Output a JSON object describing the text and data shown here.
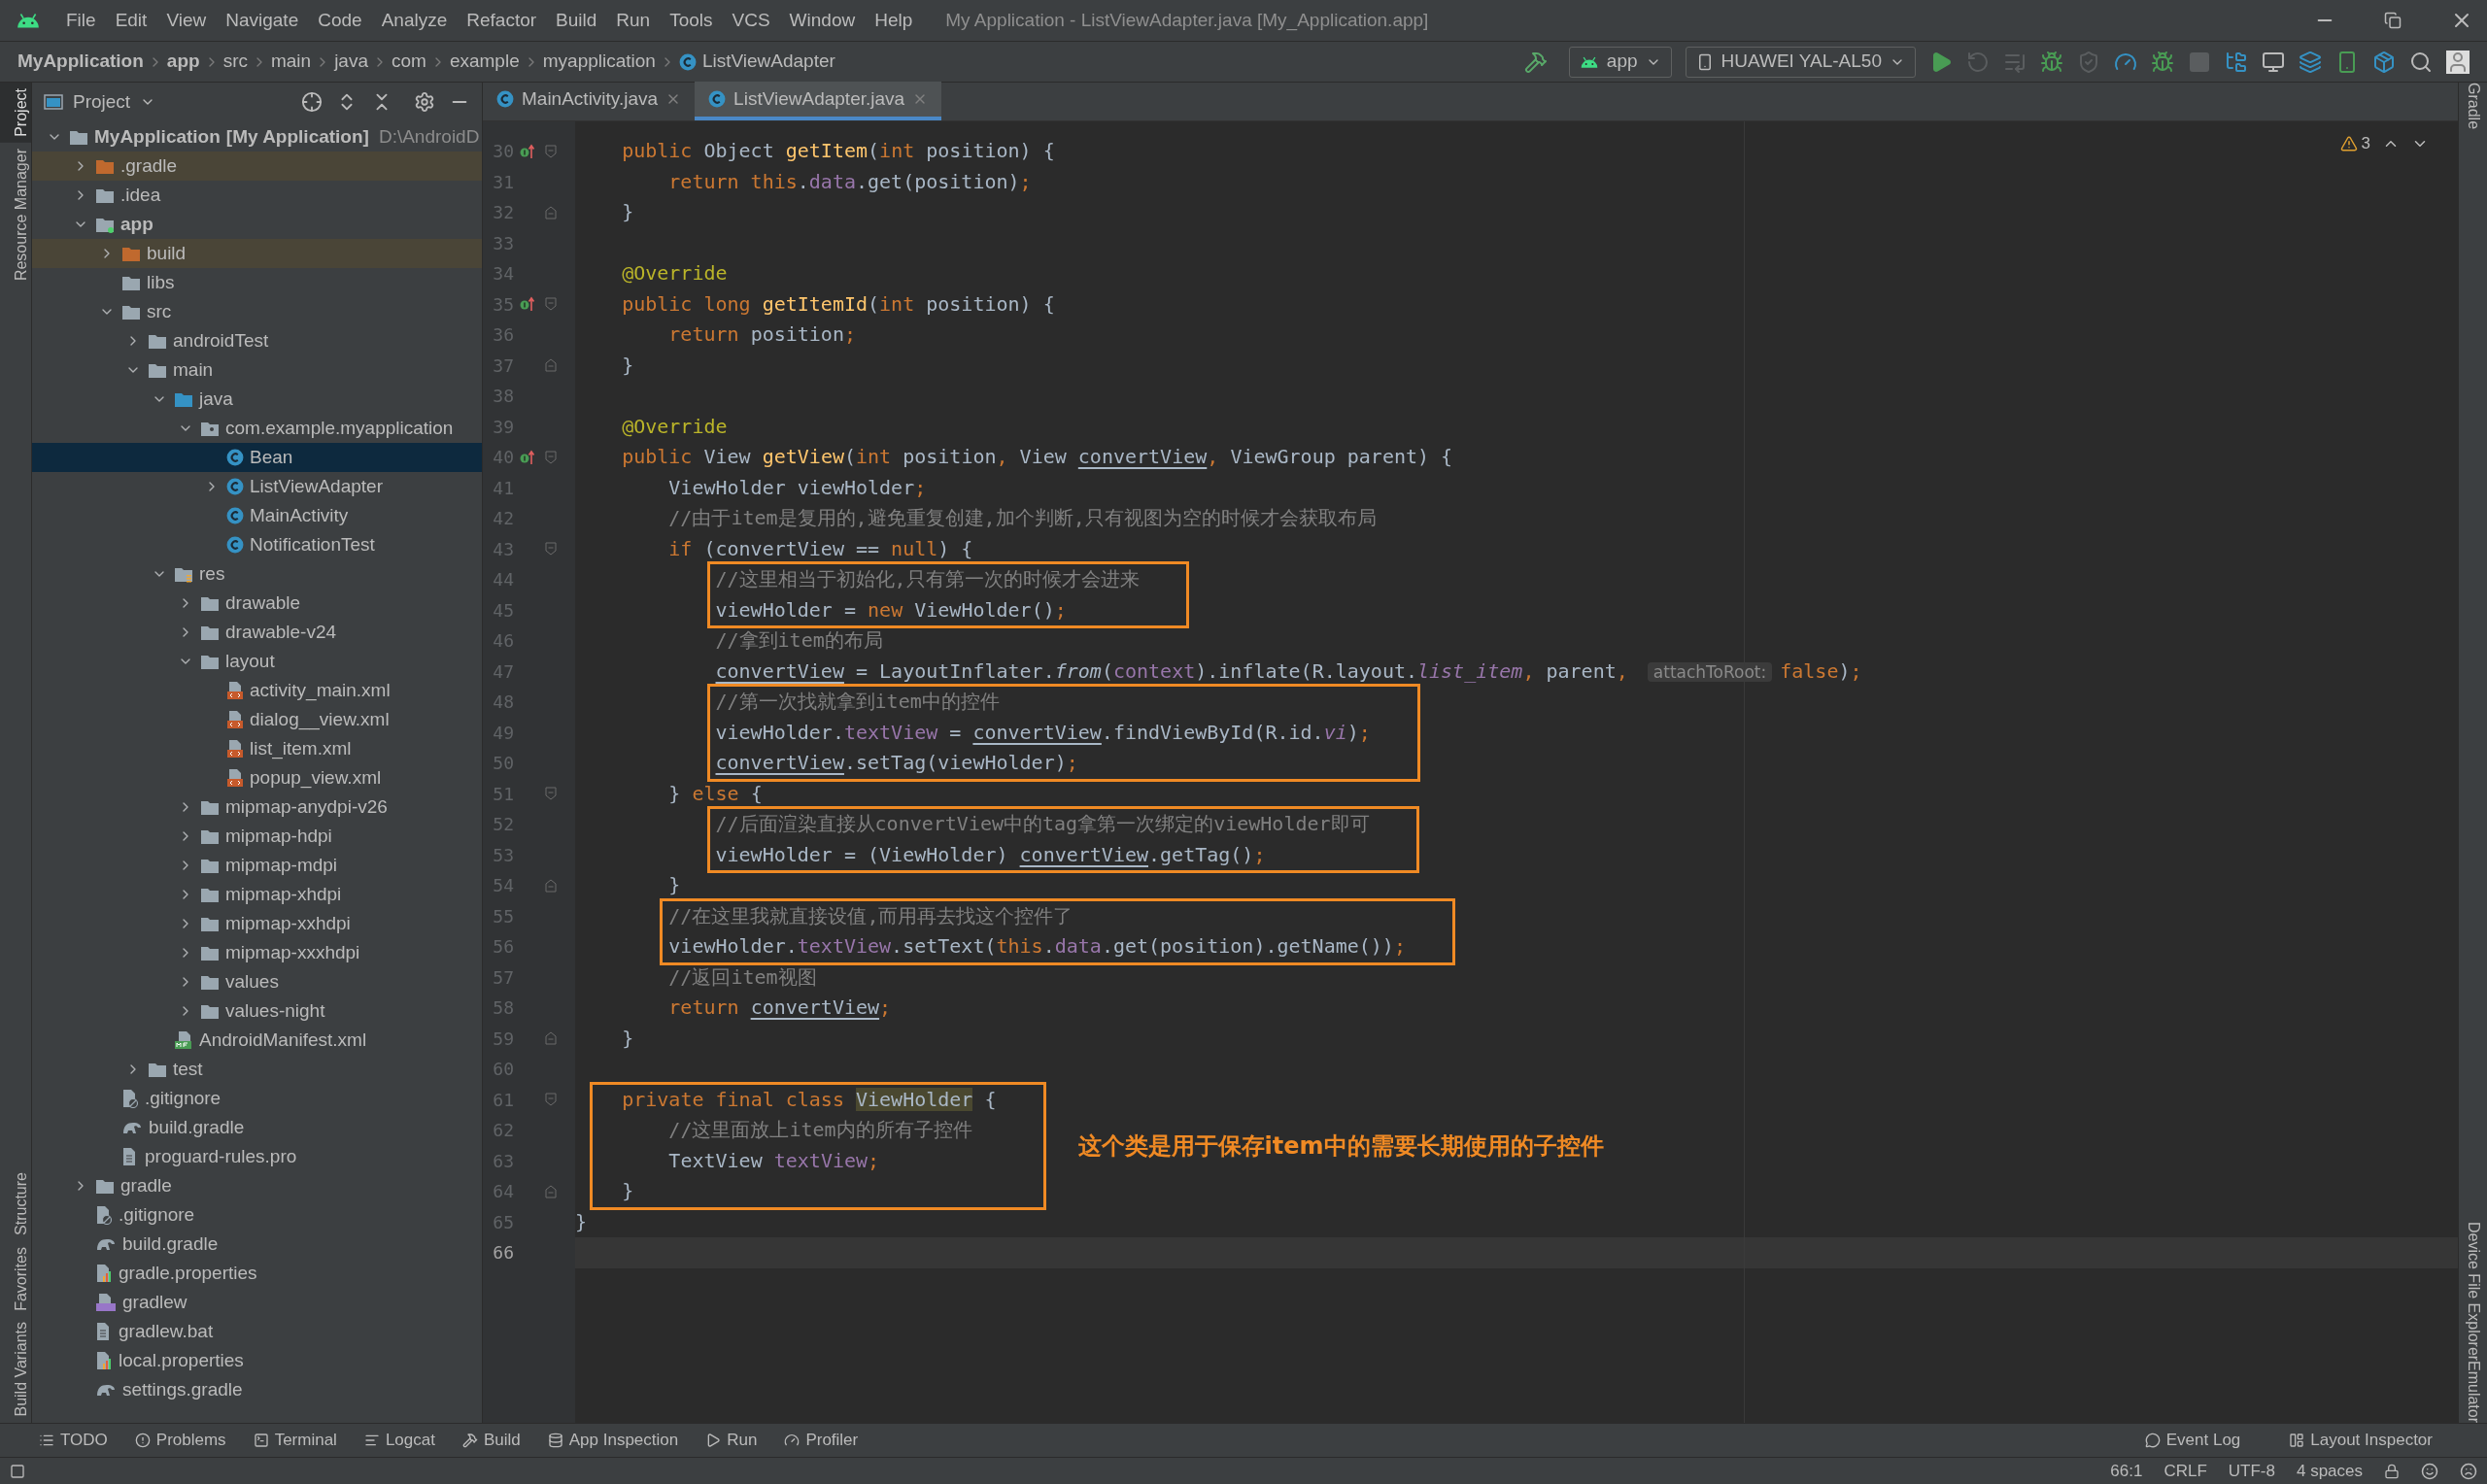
{
  "window": {
    "title": "My Application - ListViewAdapter.java [My_Application.app]"
  },
  "menu": [
    "File",
    "Edit",
    "View",
    "Navigate",
    "Code",
    "Analyze",
    "Refactor",
    "Build",
    "Run",
    "Tools",
    "VCS",
    "Window",
    "Help"
  ],
  "breadcrumb": [
    {
      "label": "MyApplication",
      "kind": "module"
    },
    {
      "label": "app",
      "kind": "module"
    },
    {
      "label": "src",
      "kind": "folder"
    },
    {
      "label": "main",
      "kind": "folder"
    },
    {
      "label": "java",
      "kind": "folder"
    },
    {
      "label": "com",
      "kind": "folder"
    },
    {
      "label": "example",
      "kind": "folder"
    },
    {
      "label": "myapplication",
      "kind": "folder"
    },
    {
      "label": "ListViewAdapter",
      "kind": "class"
    }
  ],
  "toolbar": {
    "run_config": "app",
    "device": "HUAWEI YAL-AL50"
  },
  "left_tool_tabs": {
    "top": [
      {
        "label": "Project",
        "selected": true
      },
      {
        "label": "Resource Manager",
        "selected": false
      }
    ],
    "bottom": [
      {
        "label": "Structure",
        "selected": false
      },
      {
        "label": "Favorites",
        "selected": false
      },
      {
        "label": "Build Variants",
        "selected": false
      }
    ]
  },
  "right_tool_tabs": {
    "top": [
      {
        "label": "Gradle"
      }
    ],
    "bottom": [
      {
        "label": "Device File Explorer"
      },
      {
        "label": "Emulator"
      }
    ]
  },
  "project_panel": {
    "title": "Project",
    "tree": [
      {
        "label": "MyApplication",
        "module": "[My Application]",
        "path": "D:\\AndroidD",
        "kind": "project",
        "expanded": true,
        "selected": false,
        "children": [
          {
            "label": ".gradle",
            "kind": "excluded-folder",
            "expanded": false,
            "selected": false
          },
          {
            "label": ".idea",
            "kind": "folder",
            "expanded": false,
            "selected": false
          },
          {
            "label": "app",
            "kind": "module",
            "expanded": true,
            "selected": false,
            "children": [
              {
                "label": "build",
                "kind": "excluded-folder",
                "expanded": false,
                "selected": false
              },
              {
                "label": "libs",
                "kind": "folder",
                "selected": false
              },
              {
                "label": "src",
                "kind": "folder",
                "expanded": true,
                "selected": false,
                "children": [
                  {
                    "label": "androidTest",
                    "kind": "folder",
                    "expanded": false,
                    "selected": false
                  },
                  {
                    "label": "main",
                    "kind": "folder",
                    "expanded": true,
                    "selected": false,
                    "children": [
                      {
                        "label": "java",
                        "kind": "source-folder",
                        "expanded": true,
                        "selected": false,
                        "children": [
                          {
                            "label": "com.example.myapplication",
                            "kind": "package",
                            "expanded": true,
                            "selected": false,
                            "children": [
                              {
                                "label": "Bean",
                                "kind": "class",
                                "selected": true
                              },
                              {
                                "label": "ListViewAdapter",
                                "kind": "class",
                                "expanded": false,
                                "selected": false
                              },
                              {
                                "label": "MainActivity",
                                "kind": "class",
                                "selected": false
                              },
                              {
                                "label": "NotificationTest",
                                "kind": "class",
                                "selected": false
                              }
                            ]
                          }
                        ]
                      },
                      {
                        "label": "res",
                        "kind": "res-folder",
                        "expanded": true,
                        "selected": false,
                        "children": [
                          {
                            "label": "drawable",
                            "kind": "folder",
                            "expanded": false,
                            "selected": false
                          },
                          {
                            "label": "drawable-v24",
                            "kind": "folder",
                            "expanded": false,
                            "selected": false
                          },
                          {
                            "label": "layout",
                            "kind": "folder",
                            "expanded": true,
                            "selected": false,
                            "children": [
                              {
                                "label": "activity_main.xml",
                                "kind": "xml-file",
                                "selected": false
                              },
                              {
                                "label": "dialog__view.xml",
                                "kind": "xml-file",
                                "selected": false
                              },
                              {
                                "label": "list_item.xml",
                                "kind": "xml-file",
                                "selected": false
                              },
                              {
                                "label": "popup_view.xml",
                                "kind": "xml-file",
                                "selected": false
                              }
                            ]
                          },
                          {
                            "label": "mipmap-anydpi-v26",
                            "kind": "folder",
                            "expanded": false,
                            "selected": false
                          },
                          {
                            "label": "mipmap-hdpi",
                            "kind": "folder",
                            "expanded": false,
                            "selected": false
                          },
                          {
                            "label": "mipmap-mdpi",
                            "kind": "folder",
                            "expanded": false,
                            "selected": false
                          },
                          {
                            "label": "mipmap-xhdpi",
                            "kind": "folder",
                            "expanded": false,
                            "selected": false
                          },
                          {
                            "label": "mipmap-xxhdpi",
                            "kind": "folder",
                            "expanded": false,
                            "selected": false
                          },
                          {
                            "label": "mipmap-xxxhdpi",
                            "kind": "folder",
                            "expanded": false,
                            "selected": false
                          },
                          {
                            "label": "values",
                            "kind": "folder",
                            "expanded": false,
                            "selected": false
                          },
                          {
                            "label": "values-night",
                            "kind": "folder",
                            "expanded": false,
                            "selected": false
                          }
                        ]
                      },
                      {
                        "label": "AndroidManifest.xml",
                        "kind": "manifest-file",
                        "selected": false
                      }
                    ]
                  },
                  {
                    "label": "test",
                    "kind": "folder",
                    "expanded": false,
                    "selected": false
                  }
                ]
              },
              {
                "label": ".gitignore",
                "kind": "ignore-file",
                "selected": false
              },
              {
                "label": "build.gradle",
                "kind": "gradle-file",
                "selected": false
              },
              {
                "label": "proguard-rules.pro",
                "kind": "text-file",
                "selected": false
              }
            ]
          },
          {
            "label": "gradle",
            "kind": "folder",
            "expanded": false,
            "selected": false
          },
          {
            "label": ".gitignore",
            "kind": "ignore-file",
            "selected": false
          },
          {
            "label": "build.gradle",
            "kind": "gradle-file",
            "selected": false
          },
          {
            "label": "gradle.properties",
            "kind": "properties-file",
            "selected": false
          },
          {
            "label": "gradlew",
            "kind": "script-file",
            "selected": false
          },
          {
            "label": "gradlew.bat",
            "kind": "text-file",
            "selected": false
          },
          {
            "label": "local.properties",
            "kind": "properties-file",
            "selected": false
          },
          {
            "label": "settings.gradle",
            "kind": "gradle-file",
            "selected": false
          }
        ]
      }
    ]
  },
  "editor_tabs": [
    {
      "label": "MainActivity.java",
      "selected": false
    },
    {
      "label": "ListViewAdapter.java",
      "selected": true
    }
  ],
  "inspections": {
    "warnings": "3"
  },
  "code": {
    "blocks": [
      {
        "kind": "plain",
        "lines": [
          {
            "number": "30",
            "override": true,
            "fold_start": true,
            "tokens": [
              {
                "text": "    public ",
                "kind": "keyword"
              },
              {
                "text": "Object ",
                "kind": "plain"
              },
              {
                "text": "getItem",
                "kind": "method"
              },
              {
                "text": "(",
                "kind": "plain"
              },
              {
                "text": "int ",
                "kind": "keyword"
              },
              {
                "text": "position) {",
                "kind": "plain"
              }
            ]
          },
          {
            "number": "31",
            "tokens": [
              {
                "text": "        return this",
                "kind": "keyword"
              },
              {
                "text": ".",
                "kind": "plain"
              },
              {
                "text": "data",
                "kind": "field"
              },
              {
                "text": ".get(position)",
                "kind": "plain"
              },
              {
                "text": ";",
                "kind": "keyword"
              }
            ]
          },
          {
            "number": "32",
            "fold_end": true,
            "tokens": [
              {
                "text": "    }",
                "kind": "plain"
              }
            ]
          },
          {
            "number": "33"
          },
          {
            "number": "34",
            "tokens": [
              {
                "text": "    @Override",
                "kind": "annotation"
              }
            ]
          },
          {
            "number": "35",
            "override": true,
            "fold_start": true,
            "tokens": [
              {
                "text": "    public long ",
                "kind": "keyword"
              },
              {
                "text": "getItemId",
                "kind": "method"
              },
              {
                "text": "(",
                "kind": "plain"
              },
              {
                "text": "int ",
                "kind": "keyword"
              },
              {
                "text": "position) {",
                "kind": "plain"
              }
            ]
          },
          {
            "number": "36",
            "tokens": [
              {
                "text": "        return ",
                "kind": "keyword"
              },
              {
                "text": "position",
                "kind": "plain"
              },
              {
                "text": ";",
                "kind": "keyword"
              }
            ]
          },
          {
            "number": "37",
            "fold_end": true,
            "tokens": [
              {
                "text": "    }",
                "kind": "plain"
              }
            ]
          },
          {
            "number": "38"
          },
          {
            "number": "39",
            "tokens": [
              {
                "text": "    @Override",
                "kind": "annotation"
              }
            ]
          },
          {
            "number": "40",
            "override": true,
            "fold_start": true,
            "tokens": [
              {
                "text": "    public ",
                "kind": "keyword"
              },
              {
                "text": "View ",
                "kind": "plain"
              },
              {
                "text": "getView",
                "kind": "method"
              },
              {
                "text": "(",
                "kind": "plain"
              },
              {
                "text": "int ",
                "kind": "keyword"
              },
              {
                "text": "position",
                "kind": "plain"
              },
              {
                "text": ", ",
                "kind": "keyword"
              },
              {
                "text": "View ",
                "kind": "plain"
              },
              {
                "text": "convertView",
                "kind": "reference"
              },
              {
                "text": ", ",
                "kind": "keyword"
              },
              {
                "text": "ViewGroup parent) {",
                "kind": "plain"
              }
            ]
          },
          {
            "number": "41",
            "tokens": [
              {
                "text": "        ViewHolder viewHolder",
                "kind": "plain"
              },
              {
                "text": ";",
                "kind": "keyword"
              }
            ]
          },
          {
            "number": "42",
            "tokens": [
              {
                "text": "        //由于item是复用的,避免重复创建,加个判断,只有视图为空的时候才会获取布局",
                "kind": "comment"
              }
            ]
          },
          {
            "number": "43",
            "fold_start": true,
            "tokens": [
              {
                "text": "        if ",
                "kind": "keyword"
              },
              {
                "text": "(convertView == ",
                "kind": "plain"
              },
              {
                "text": "null",
                "kind": "keyword"
              },
              {
                "text": ") {",
                "kind": "plain"
              }
            ]
          }
        ]
      },
      {
        "kind": "boxed-nested",
        "lines": [
          {
            "number": "44",
            "tokens": [
              {
                "text": "//这里相当于初始化,只有第一次的时候才会进来",
                "kind": "comment"
              }
            ]
          },
          {
            "number": "45",
            "tokens": [
              {
                "text": "viewHolder = ",
                "kind": "plain"
              },
              {
                "text": "new ",
                "kind": "keyword"
              },
              {
                "text": "ViewHolder()",
                "kind": "plain"
              },
              {
                "text": ";",
                "kind": "keyword"
              }
            ]
          }
        ]
      },
      {
        "kind": "plain",
        "lines": [
          {
            "number": "46",
            "tokens": [
              {
                "text": "            //拿到item的布局",
                "kind": "comment"
              }
            ]
          },
          {
            "number": "47",
            "tokens": [
              {
                "text": "            convertView",
                "kind": "reference"
              },
              {
                "text": " = LayoutInflater.",
                "kind": "plain"
              },
              {
                "text": "from",
                "kind": "static-method"
              },
              {
                "text": "(",
                "kind": "plain"
              },
              {
                "text": "context",
                "kind": "field"
              },
              {
                "text": ").inflate(R.layout.",
                "kind": "plain"
              },
              {
                "text": "list_item",
                "kind": "static-field"
              },
              {
                "text": ", ",
                "kind": "keyword"
              },
              {
                "text": "parent",
                "kind": "plain"
              },
              {
                "text": ", ",
                "kind": "keyword"
              },
              {
                "text": "attachToRoot:",
                "kind": "hint"
              },
              {
                "text": "false",
                "kind": "keyword"
              },
              {
                "text": ")",
                "kind": "plain"
              },
              {
                "text": ";",
                "kind": "keyword"
              }
            ]
          }
        ]
      },
      {
        "kind": "boxed-nested",
        "lines": [
          {
            "number": "48",
            "tokens": [
              {
                "text": "//第一次找就拿到item中的控件",
                "kind": "comment"
              }
            ]
          },
          {
            "number": "49",
            "tokens": [
              {
                "text": "viewHolder.",
                "kind": "plain"
              },
              {
                "text": "textView",
                "kind": "field"
              },
              {
                "text": " = ",
                "kind": "plain"
              },
              {
                "text": "convertView",
                "kind": "reference"
              },
              {
                "text": ".findViewById(R.id.",
                "kind": "plain"
              },
              {
                "text": "vi",
                "kind": "static-field"
              },
              {
                "text": ")",
                "kind": "plain"
              },
              {
                "text": ";",
                "kind": "keyword"
              }
            ]
          },
          {
            "number": "50",
            "tokens": [
              {
                "text": "convertView",
                "kind": "reference"
              },
              {
                "text": ".setTag(viewHolder)",
                "kind": "plain"
              },
              {
                "text": ";",
                "kind": "keyword"
              }
            ]
          }
        ]
      },
      {
        "kind": "plain",
        "lines": [
          {
            "number": "51",
            "fold_start": true,
            "tokens": [
              {
                "text": "        } ",
                "kind": "plain"
              },
              {
                "text": "else ",
                "kind": "keyword"
              },
              {
                "text": "{",
                "kind": "plain"
              }
            ]
          }
        ]
      },
      {
        "kind": "boxed-nested",
        "lines": [
          {
            "number": "52",
            "tokens": [
              {
                "text": "//后面渲染直接从convertView中的tag拿第一次绑定的viewHolder即可",
                "kind": "comment"
              }
            ]
          },
          {
            "number": "53",
            "tokens": [
              {
                "text": "viewHolder = (ViewHolder) ",
                "kind": "plain"
              },
              {
                "text": "convertView",
                "kind": "reference"
              },
              {
                "text": ".getTag()",
                "kind": "plain"
              },
              {
                "text": ";",
                "kind": "keyword"
              }
            ]
          }
        ]
      },
      {
        "kind": "plain",
        "lines": [
          {
            "number": "54",
            "fold_end": true,
            "tokens": [
              {
                "text": "        }",
                "kind": "plain"
              }
            ]
          }
        ]
      },
      {
        "kind": "boxed-statement",
        "lines": [
          {
            "number": "55",
            "tokens": [
              {
                "text": "//在这里我就直接设值,而用再去找这个控件了",
                "kind": "comment"
              }
            ]
          },
          {
            "number": "56",
            "tokens": [
              {
                "text": "viewHolder.",
                "kind": "plain"
              },
              {
                "text": "textView",
                "kind": "field"
              },
              {
                "text": ".setText(",
                "kind": "plain"
              },
              {
                "text": "this",
                "kind": "keyword"
              },
              {
                "text": ".",
                "kind": "plain"
              },
              {
                "text": "data",
                "kind": "field"
              },
              {
                "text": ".get(position).getName())",
                "kind": "plain"
              },
              {
                "text": ";",
                "kind": "keyword"
              }
            ]
          }
        ]
      },
      {
        "kind": "plain",
        "lines": [
          {
            "number": "57",
            "tokens": [
              {
                "text": "        //返回item视图",
                "kind": "comment"
              }
            ]
          },
          {
            "number": "58",
            "tokens": [
              {
                "text": "        return ",
                "kind": "keyword"
              },
              {
                "text": "convertView",
                "kind": "reference"
              },
              {
                "text": ";",
                "kind": "keyword"
              }
            ]
          },
          {
            "number": "59",
            "fold_end": true,
            "tokens": [
              {
                "text": "    }",
                "kind": "plain"
              }
            ]
          },
          {
            "number": "60"
          }
        ]
      },
      {
        "kind": "boxed-member",
        "note": "这个类是用于保存item中的需要长期使用的子控件",
        "lines": [
          {
            "number": "61",
            "fold_start": true,
            "tokens": [
              {
                "text": "  private final class ",
                "kind": "keyword"
              },
              {
                "text": "ViewHolder",
                "kind": "highlight"
              },
              {
                "text": " {",
                "kind": "plain"
              }
            ]
          },
          {
            "number": "62",
            "tokens": [
              {
                "text": "      //这里面放上item内的所有子控件",
                "kind": "comment"
              }
            ]
          },
          {
            "number": "63",
            "tokens": [
              {
                "text": "      TextView ",
                "kind": "plain"
              },
              {
                "text": "textView",
                "kind": "field"
              },
              {
                "text": ";",
                "kind": "keyword"
              }
            ]
          },
          {
            "number": "64",
            "fold_end": true,
            "tokens": [
              {
                "text": "  }",
                "kind": "plain"
              }
            ]
          }
        ]
      },
      {
        "kind": "plain",
        "lines": [
          {
            "number": "65",
            "tokens": [
              {
                "text": "}",
                "kind": "plain"
              }
            ]
          },
          {
            "number": "66",
            "current": true
          }
        ]
      }
    ]
  },
  "tool_windows": [
    {
      "label": "TODO",
      "kind": "todo"
    },
    {
      "label": "Problems",
      "kind": "problems"
    },
    {
      "label": "Terminal",
      "kind": "terminal"
    },
    {
      "label": "Logcat",
      "kind": "logcat"
    },
    {
      "label": "Build",
      "kind": "build"
    },
    {
      "label": "App Inspection",
      "kind": "inspection"
    },
    {
      "label": "Run",
      "kind": "run"
    },
    {
      "label": "Profiler",
      "kind": "profiler"
    }
  ],
  "tool_windows_right": [
    {
      "label": "Event Log",
      "kind": "event-log"
    },
    {
      "label": "Layout Inspector",
      "kind": "layout-inspector"
    }
  ],
  "status_bar": {
    "position": "66:1",
    "line_separator": "CRLF",
    "encoding": "UTF-8",
    "indent": "4 spaces"
  }
}
